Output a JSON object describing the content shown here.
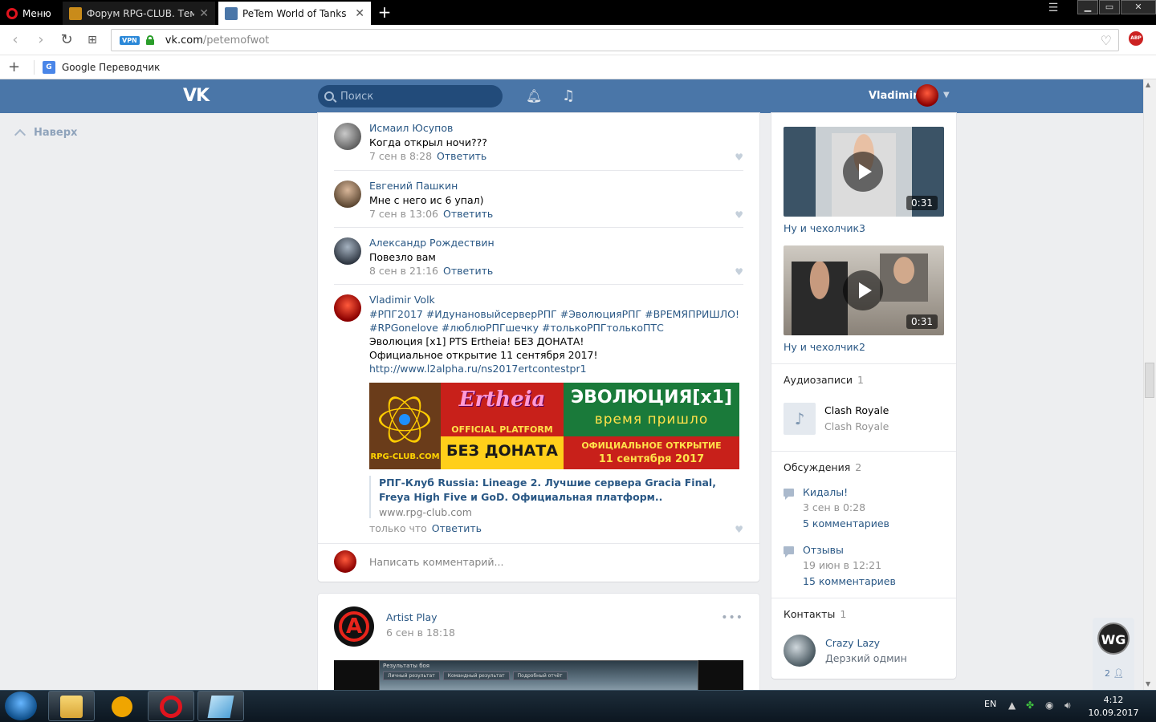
{
  "browser": {
    "menu_label": "Меню",
    "tabs": [
      {
        "title": "Форум RPG-CLUB. Тема: З"
      },
      {
        "title": "PeTem World of Tanks BLI"
      }
    ],
    "new_tab": "+",
    "url_domain": "vk.com",
    "url_path": "/petemofwot",
    "vpn_badge": "VPN",
    "abp_badge": "ABP",
    "bookmarks": [
      {
        "label": "Google Переводчик"
      }
    ]
  },
  "vk_header": {
    "logo": "VK",
    "search_placeholder": "Поиск",
    "user_name": "Vladimir"
  },
  "left_nav": {
    "up_label": "Наверх"
  },
  "comments": [
    {
      "author": "Исмаил Юсупов",
      "text": "Когда открыл ночи???",
      "date": "7 сен в 8:28",
      "reply": "Ответить"
    },
    {
      "author": "Евгений Пашкин",
      "text": "Мне с него ис 6 упал)",
      "date": "7 сен в 13:06",
      "reply": "Ответить"
    },
    {
      "author": "Александр Рождествин",
      "text": "Повезло вам",
      "date": "8 сен в 21:16",
      "reply": "Ответить"
    }
  ],
  "vladimir_comment": {
    "author": "Vladimir Volk",
    "hashtags_line1": "#РПГ2017 #ИдунановыйсерверРПГ #ЭволюцияРПГ #ВРЕМЯПРИШЛО!",
    "hashtags_line2": "#RPGonelove #люблюРПГшечку #толькоРПГтолькоПТС",
    "line3": "Эволюция [x1] PTS Ertheia! БЕЗ ДОНАТА!",
    "line4": "Официальное открытие 11 сентября 2017!",
    "link": "http://www.l2alpha.ru/ns2017ertcontestpr1",
    "banner": {
      "club": "RPG-CLUB.COM",
      "ertheia": "Ertheia",
      "official": "OFFICIAL PLATFORM",
      "no_donate": "БЕЗ ДОНАТА",
      "evo": "ЭВОЛЮЦИЯ[x1]",
      "time": "время пришло",
      "opening": "ОФИЦИАЛЬНОЕ ОТКРЫТИЕ",
      "date": "11 сентября 2017"
    },
    "link_title": "РПГ-Клуб Russia: Lineage 2. Лучшие сервера Gracia Final, Freya High Five и GoD. Официальная платформ..",
    "link_domain": "www.rpg-club.com",
    "date": "только что",
    "reply": "Ответить"
  },
  "write_comment_placeholder": "Написать комментарий...",
  "post2": {
    "author": "Artist Play",
    "date": "6 сен в 18:18",
    "img_title": "Результаты боя",
    "img_tabs": [
      "Личный результат",
      "Командный результат",
      "Подробный отчёт"
    ]
  },
  "right": {
    "videos": [
      {
        "title": "Ну и чехолчик3",
        "duration": "0:31"
      },
      {
        "title": "Ну и чехолчик2",
        "duration": "0:31"
      }
    ],
    "audio_header": "Аудиозаписи",
    "audio_count": "1",
    "audio": {
      "title": "Clash Royale",
      "artist": "Clash Royale"
    },
    "disc_header": "Обсуждения",
    "disc_count": "2",
    "discussions": [
      {
        "title": "Кидалы!",
        "date": "3 сен в 0:28",
        "comments": "5 комментариев"
      },
      {
        "title": "Отзывы",
        "date": "19 июн в 12:21",
        "comments": "15 комментариев"
      }
    ],
    "contacts_header": "Контакты",
    "contacts_count": "1",
    "contact": {
      "name": "Crazy Lazy",
      "role": "Дерзкий одмин"
    }
  },
  "wg_widget": {
    "logo": "WG",
    "count": "2"
  },
  "taskbar": {
    "lang": "EN",
    "time": "4:12",
    "date": "10.09.2017"
  }
}
